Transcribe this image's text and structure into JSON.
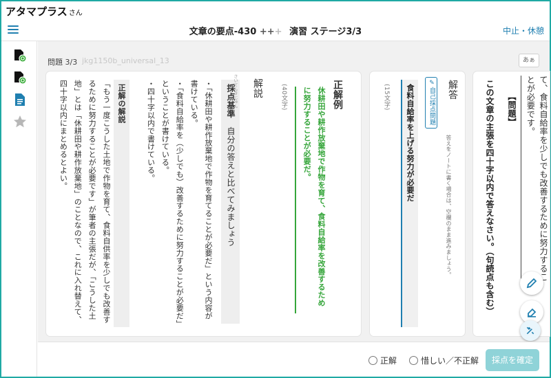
{
  "brand": {
    "name": "アタマプラス",
    "suffix": "さん"
  },
  "header": {
    "title": "文章の要点-430",
    "plus_active": "++",
    "plus_dim": "+",
    "stage": "演習 ステージ3/3",
    "pause_label": "中止・休憩"
  },
  "question": {
    "label": "問題 3/3",
    "id": "jkg1150b_universal_13",
    "font_toggle": "あぁ"
  },
  "explanation": {
    "heading": "正解例",
    "correct_answer": "休耕田や耕作放棄地で作物を育て、食料自給率を改善するために努力することが必要だ。",
    "char_count": "(40文字)",
    "kaisetsu_heading": "解説",
    "criteria_ruby": "さいてんきじゅん",
    "criteria_label": "採点基準",
    "criteria_text": "自分の答えと比べてみましょう",
    "criteria_ruby2": "くら",
    "criteria_items": [
      "・「休耕田や耕作放棄地で作物を育てることが必要だ」という内容が書けている。",
      "・「食料自給率を（少しでも）改善するために努力することが必要だ」ということが書けている。",
      "・四十字以内で書けている。"
    ],
    "correct_reason_label": "正解の解説",
    "correct_reason_text": "「もう一度こうした土地で作物を育て、食料自供率を少しでも改善するために努力することが必要です」が筆者の主張だが、「こうした土地」とは「休耕田や耕作放棄地」のことなので、これに入れ替えて、四十字以内にまとめるとよい。"
  },
  "answer_card": {
    "heading": "解答",
    "badge": "自己採点問題",
    "note": "答えをノートに書く場合は、空欄のまま進みましょう。",
    "user_answer": "食料自給率を上げる努力が必要だ",
    "char_count": "(15文字)"
  },
  "problem_card": {
    "label": "【問題】",
    "prompt": "この文章の主張を四十字以内で答えなさい。（句読点も含む）",
    "passage": "て、食料自給率を少しでも改善するために努力することが必要です。"
  },
  "footer": {
    "radio_correct": "正解",
    "radio_partial": "惜しい／不正解",
    "submit_label": "採点を確定"
  },
  "colors": {
    "accent": "#1fa9a4",
    "correct_green": "#35a53a",
    "link_blue": "#1f7fb0"
  },
  "icons": {
    "side": [
      "book-check-icon",
      "book-check-icon",
      "document-icon",
      "star-icon"
    ],
    "tools": [
      "pencil-icon",
      "eraser-icon",
      "tools-icon"
    ]
  }
}
